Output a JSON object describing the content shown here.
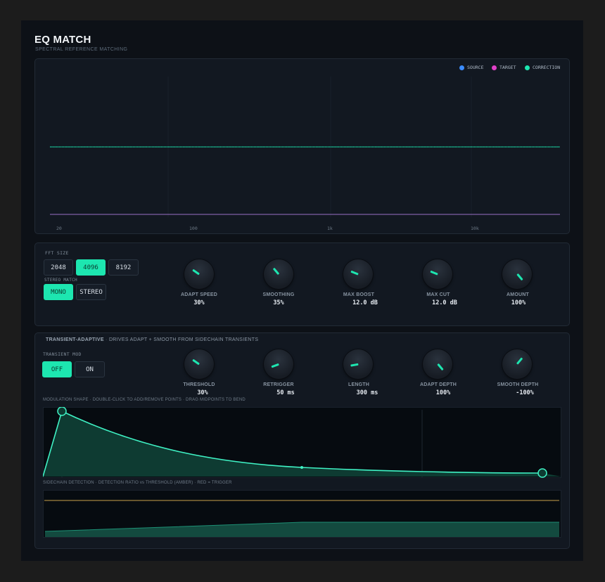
{
  "header": {
    "title": "EQ MATCH",
    "subtitle": "SPECTRAL REFERENCE MATCHING"
  },
  "spectrum": {
    "legend": [
      {
        "label": "SOURCE",
        "color": "#3b8cff"
      },
      {
        "label": "TARGET",
        "color": "#e040c8"
      },
      {
        "label": "CORRECTION",
        "color": "#1de6b0"
      }
    ],
    "freq_labels": [
      "20",
      "100",
      "1k",
      "10k"
    ]
  },
  "fft": {
    "label": "FFT SIZE",
    "options": [
      "2048",
      "4096",
      "8192"
    ],
    "selected": "4096"
  },
  "stereo": {
    "label": "STEREO MATCH",
    "options": [
      "MONO",
      "STEREO"
    ],
    "selected": "MONO"
  },
  "knobs_main": [
    {
      "label": "ADAPT SPEED",
      "value": "30%"
    },
    {
      "label": "SMOOTHING",
      "value": "35%"
    },
    {
      "label": "MAX BOOST",
      "value": "12.0 dB"
    },
    {
      "label": "MAX CUT",
      "value": "12.0 dB"
    },
    {
      "label": "AMOUNT",
      "value": "100%"
    }
  ],
  "transient": {
    "title": "TRANSIENT-ADAPTIVE",
    "description": "DRIVES ADAPT + SMOOTH FROM SIDECHAIN TRANSIENTS",
    "mod_label": "TRANSIENT MOD",
    "options": [
      "OFF",
      "ON"
    ],
    "selected": "OFF",
    "knobs": [
      {
        "label": "THRESHOLD",
        "value": "30%"
      },
      {
        "label": "RETRIGGER",
        "value": "50 ms"
      },
      {
        "label": "LENGTH",
        "value": "300 ms"
      },
      {
        "label": "ADAPT DEPTH",
        "value": "100%"
      },
      {
        "label": "SMOOTH DEPTH",
        "value": "-100%"
      }
    ],
    "mod_shape_caption": "MODULATION SHAPE · DOUBLE-CLICK TO ADD/REMOVE POINTS · DRAG MIDPOINTS TO BEND",
    "sidechain_caption": "SIDECHAIN DETECTION · DETECTION RATIO vs THRESHOLD (AMBER) · RED = TRIGGER"
  },
  "colors": {
    "accent": "#1de6b0",
    "threshold": "#c9a24a"
  }
}
